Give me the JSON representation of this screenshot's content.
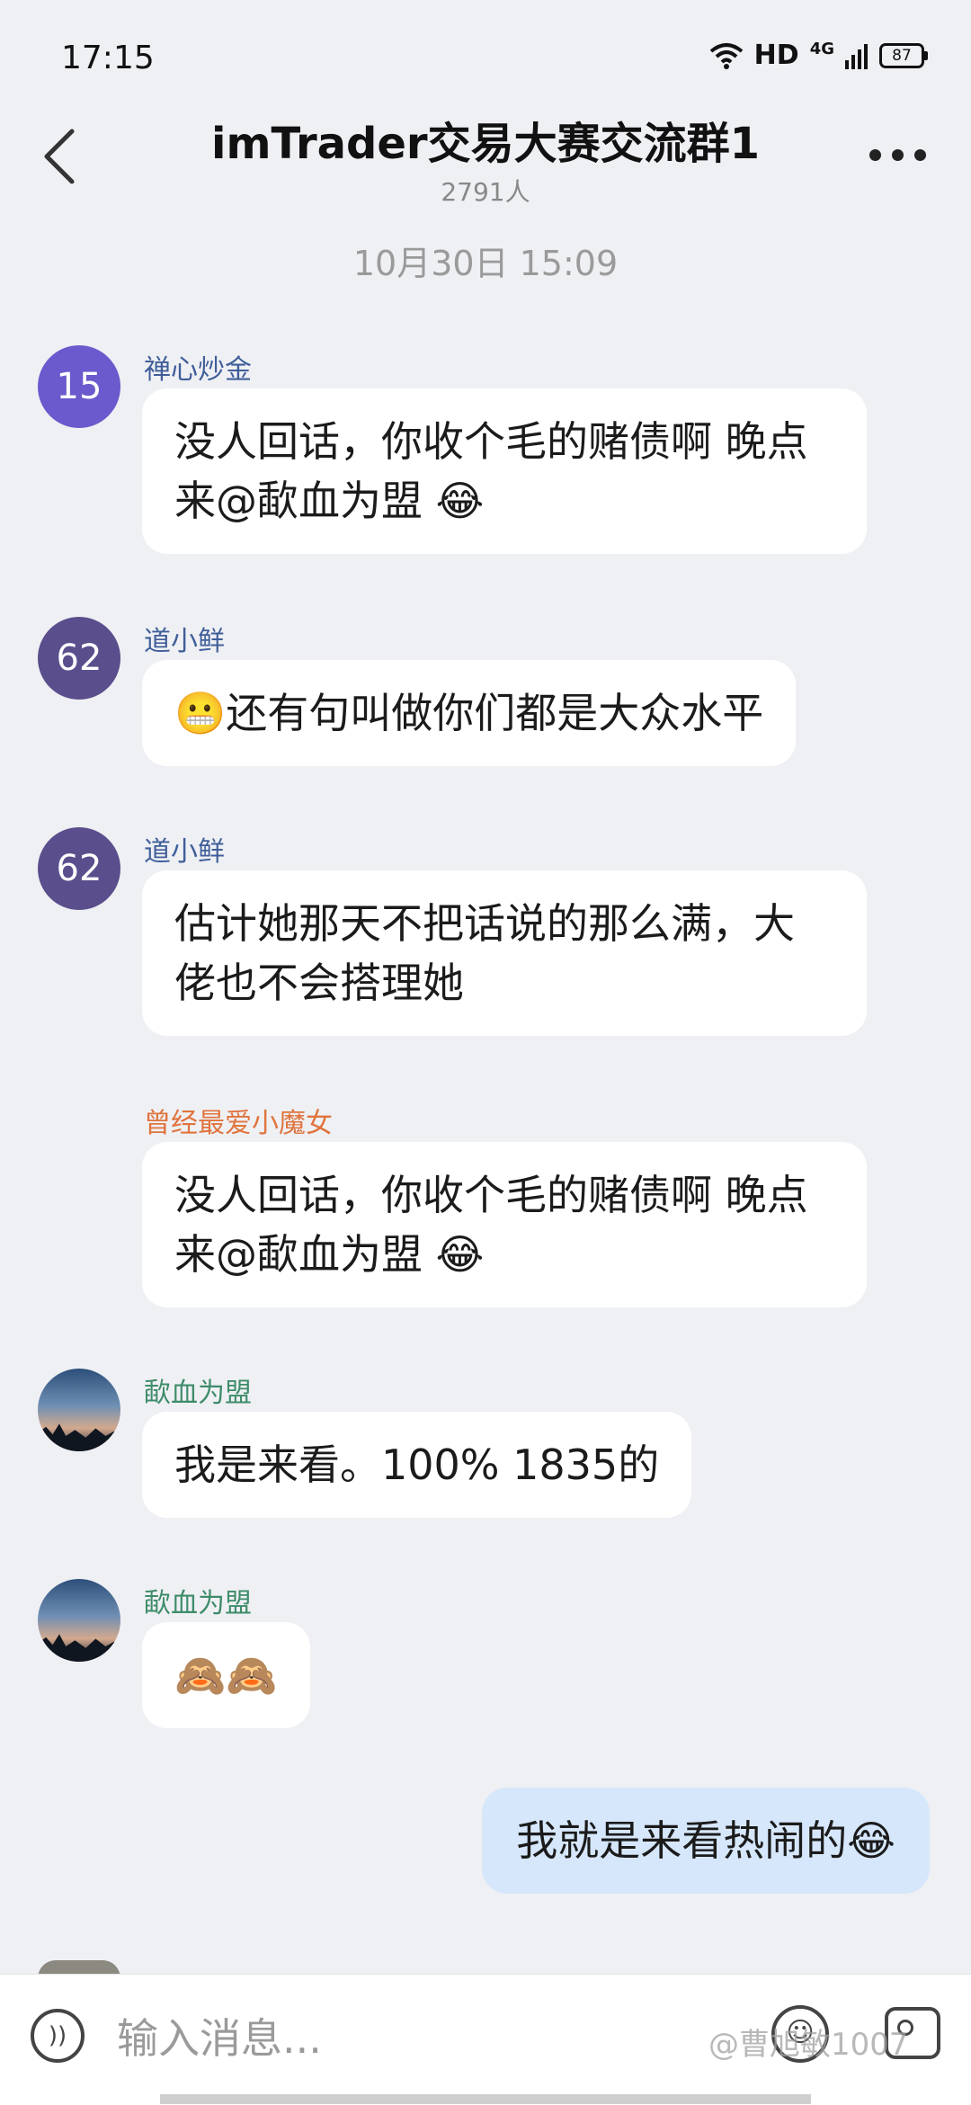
{
  "status_bar": {
    "time": "17:15",
    "hd": "HD",
    "network": "4G",
    "battery": "87"
  },
  "header": {
    "title": "imTrader交易大赛交流群1",
    "member_count": "2791人"
  },
  "time_divider": "10月30日 15:09",
  "messages": [
    {
      "avatar_text": "15",
      "sender": "禅心炒金",
      "text": "没人回话，你收个毛的赌债啊 晚点来@歃血为盟 😂"
    },
    {
      "avatar_text": "62",
      "sender": "道小鲜",
      "text": "😬还有句叫做你们都是大众水平"
    },
    {
      "avatar_text": "62",
      "sender": "道小鲜",
      "text": "估计她那天不把话说的那么满，大佬也不会搭理她"
    },
    {
      "avatar_text": "",
      "sender": "曾经最爱小魔女",
      "text": "没人回话，你收个毛的赌债啊 晚点来@歃血为盟 😂"
    },
    {
      "avatar_text": "",
      "sender": "歃血为盟",
      "text": "我是来看。100% 1835的"
    },
    {
      "avatar_text": "",
      "sender": "歃血为盟",
      "text": "🙈🙈"
    }
  ],
  "outgoing_message": "我就是来看热闹的😂",
  "input": {
    "placeholder": "输入消息..."
  },
  "watermark": "@曹旭敏1007",
  "colors": {
    "background": "#eff0f4",
    "outgoing_bubble": "#d6e7fb",
    "sender_blue": "#3f5e99",
    "sender_orange": "#e0743e",
    "sender_green": "#3e8c6a"
  }
}
